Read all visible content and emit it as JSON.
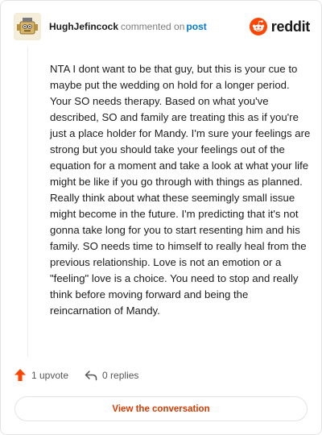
{
  "header": {
    "username": "HughJefincock",
    "commented_text": "commented on",
    "post_link": "post",
    "brand": "reddit"
  },
  "comment": {
    "body": "NTA I dont want to be that guy, but this is your cue to maybe put the wedding on hold for a longer period. Your SO needs therapy. Based on what you've described, SO and family are treating this as if you're just a place holder for Mandy. I'm sure your feelings are strong but you should take your feelings out of the equation for a moment and take a look at what your life might be like if you go through with things as planned. Really think about what these seemingly small issue might become in the future. I'm predicting that it's not gonna take long for you to start resenting him and his family. SO needs time to himself to really heal from the previous relationship. Love is not an emotion or a \"feeling\" love is a choice. You need to stop and really think before moving forward and being the reincarnation of Mandy."
  },
  "actions": {
    "upvotes": "1 upvote",
    "replies": "0 replies"
  },
  "footer": {
    "view_conversation": "View the conversation"
  },
  "colors": {
    "upvote": "#ff4500",
    "link": "#0079d3",
    "button_text": "#d93a00"
  },
  "icons": {
    "avatar": "snoo-avatar",
    "brand": "reddit-logo-icon",
    "upvote": "upvote-arrow-icon",
    "reply": "reply-arrow-icon"
  }
}
